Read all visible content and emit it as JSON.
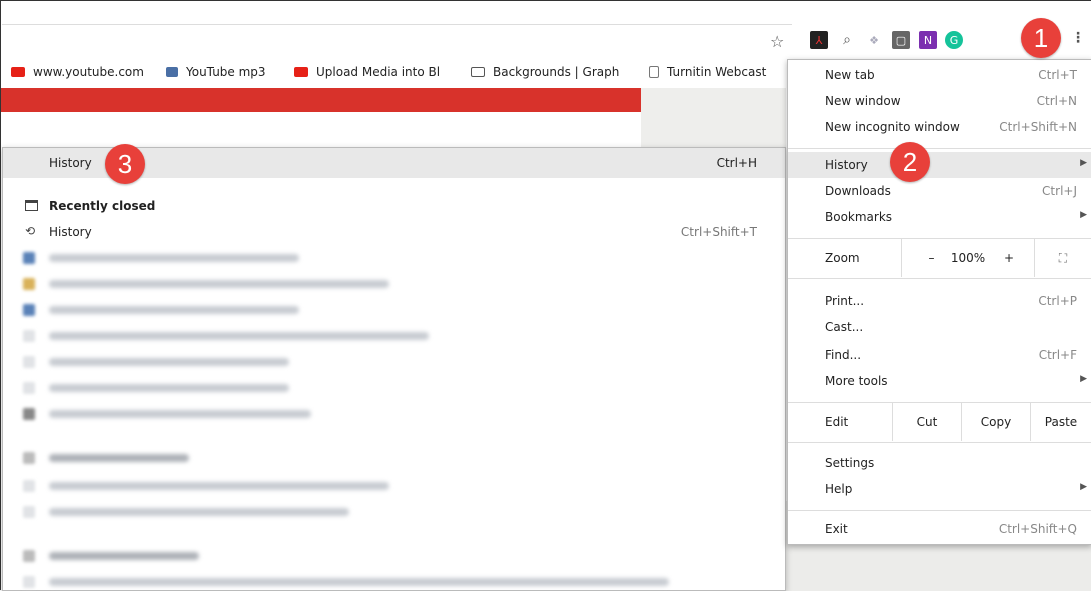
{
  "toolbar": {
    "extensions": [
      {
        "name": "acrobat-icon",
        "glyph": "⅄",
        "color": "#b30b00"
      },
      {
        "name": "search-icon",
        "glyph": "🔍",
        "color": "#ffffff"
      },
      {
        "name": "dropbox-icon",
        "glyph": "❖",
        "color": "#ffffff"
      },
      {
        "name": "extension-icon",
        "glyph": "■",
        "color": "#555555"
      },
      {
        "name": "onenote-icon",
        "glyph": "N",
        "color": "#7b2fb0"
      },
      {
        "name": "grammarly-icon",
        "glyph": "G",
        "color": "#15c39a"
      }
    ]
  },
  "bookmarks": [
    {
      "label": "www.youtube.com",
      "icon": "youtube-icon",
      "color": "#e62117"
    },
    {
      "label": "YouTube mp3",
      "icon": "ytmp3-icon",
      "color": "#4a6fa5"
    },
    {
      "label": "Upload Media into Bl",
      "icon": "youtube-icon",
      "color": "#e62117"
    },
    {
      "label": "Backgrounds | Graph",
      "icon": "image-icon",
      "color": "#555555"
    },
    {
      "label": "Turnitin Webcast",
      "icon": "page-icon",
      "color": "#777777"
    }
  ],
  "history_submenu": {
    "title": "History",
    "title_shortcut": "Ctrl+H",
    "recently_closed": "Recently closed",
    "history_item": "History",
    "history_shortcut": "Ctrl+Shift+T"
  },
  "menu": {
    "items_top": [
      {
        "label": "New tab",
        "shortcut": "Ctrl+T"
      },
      {
        "label": "New window",
        "shortcut": "Ctrl+N"
      },
      {
        "label": "New incognito window",
        "shortcut": "Ctrl+Shift+N"
      }
    ],
    "items_mid": [
      {
        "label": "History",
        "shortcut": ""
      },
      {
        "label": "Downloads",
        "shortcut": "Ctrl+J"
      },
      {
        "label": "Bookmarks",
        "shortcut": ""
      }
    ],
    "zoom": {
      "label": "Zoom",
      "minus": "–",
      "value": "100%",
      "plus": "+"
    },
    "items_print": [
      {
        "label": "Print...",
        "shortcut": "Ctrl+P"
      },
      {
        "label": "Cast...",
        "shortcut": ""
      },
      {
        "label": "Find...",
        "shortcut": "Ctrl+F"
      },
      {
        "label": "More tools",
        "shortcut": ""
      }
    ],
    "edit": {
      "label": "Edit",
      "cut": "Cut",
      "copy": "Copy",
      "paste": "Paste"
    },
    "settings": "Settings",
    "help": "Help",
    "exit": "Exit",
    "exit_shortcut": "Ctrl+Shift+Q"
  },
  "badges": [
    "1",
    "2",
    "3"
  ],
  "accent_color": "#e8403a"
}
